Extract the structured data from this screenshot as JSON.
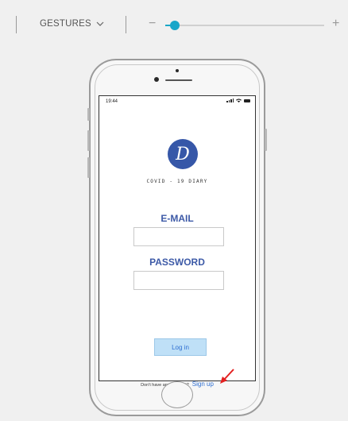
{
  "toolbar": {
    "gestures_label": "GESTURES",
    "zoom_minus": "−",
    "zoom_plus": "+",
    "zoom_level_fraction": 0.06
  },
  "status_bar": {
    "time": "19:44"
  },
  "app": {
    "logo_letter": "D",
    "name": "COVID - 19 DIARY"
  },
  "form": {
    "email_label": "E-MAIL",
    "email_value": "",
    "password_label": "PASSWORD",
    "password_value": "",
    "login_button": "Log in"
  },
  "signup": {
    "prompt": "Don't have any Account?",
    "link": "Sign up"
  },
  "colors": {
    "accent": "#3657a8",
    "link": "#2f6fd1",
    "slider": "#18a6c9",
    "arrow": "#e32020"
  }
}
